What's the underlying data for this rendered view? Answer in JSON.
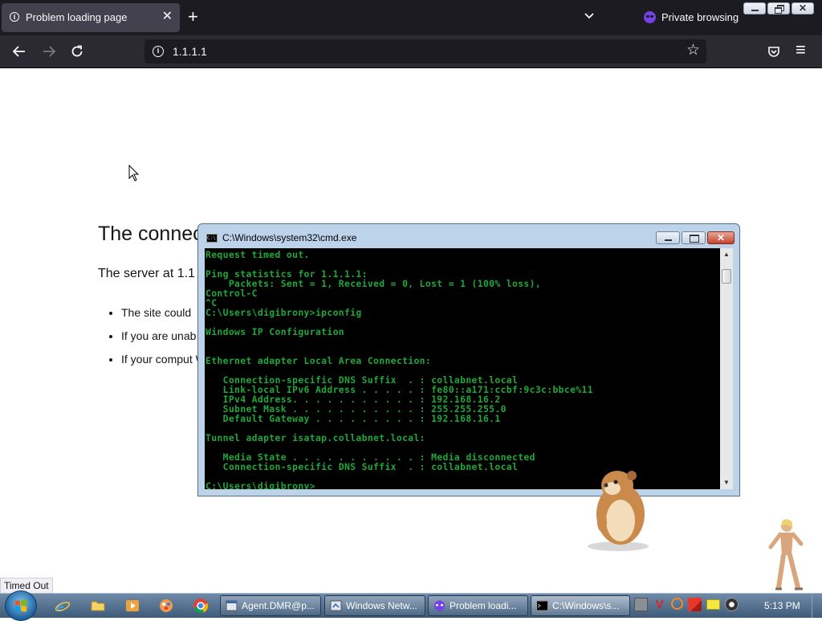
{
  "browser": {
    "tab": {
      "title": "Problem loading page",
      "close_glyph": "✕"
    },
    "new_tab_glyph": "+",
    "private_label": "Private browsing",
    "url": "1.1.1.1",
    "info_glyph": "i",
    "star_glyph": "☆",
    "menu_glyph": "≡"
  },
  "page": {
    "title": "The connec",
    "description": "The server at 1.1",
    "bullets": [
      "The site could",
      "If you are unab",
      "If your comput Web."
    ],
    "status": "Timed Out"
  },
  "cmd_window": {
    "title": "C:\\Windows\\system32\\cmd.exe",
    "icon_text": "C:\\",
    "close_glyph": "✕",
    "output": "Request timed out.\n\nPing statistics for 1.1.1.1:\n    Packets: Sent = 1, Received = 0, Lost = 1 (100% loss),\nControl-C\n^C\nC:\\Users\\digibrony>ipconfig\n\nWindows IP Configuration\n\n\nEthernet adapter Local Area Connection:\n\n   Connection-specific DNS Suffix  . : collabnet.local\n   Link-local IPv6 Address . . . . . : fe80::a171:ccbf:9c3c:bbce%11\n   IPv4 Address. . . . . . . . . . . : 192.168.16.2\n   Subnet Mask . . . . . . . . . . . : 255.255.255.0\n   Default Gateway . . . . . . . . . : 192.168.16.1\n\nTunnel adapter isatap.collabnet.local:\n\n   Media State . . . . . . . . . . . : Media disconnected\n   Connection-specific DNS Suffix  . : collabnet.local\n\nC:\\Users\\digibrony>"
  },
  "taskbar": {
    "pinned": [
      "internet-explorer-icon",
      "file-explorer-icon",
      "media-player-icon",
      "paint-icon",
      "chrome-icon"
    ],
    "windows": [
      {
        "label": "Agent.DMR@p...",
        "icon": "window-icon"
      },
      {
        "label": "Windows Netw...",
        "icon": "network-icon"
      },
      {
        "label": "Problem loadi...",
        "icon": "firefox-private-icon"
      },
      {
        "label": "C:\\Windows\\s...",
        "icon": "cmd-icon"
      }
    ],
    "clock": "5:13 PM"
  },
  "colors": {
    "firefox_tabbar": "#1c1b22",
    "firefox_navbar": "#2b2a33",
    "private_purple": "#7542e5",
    "console_text": "#1fa83a",
    "console_bg": "#000000"
  }
}
